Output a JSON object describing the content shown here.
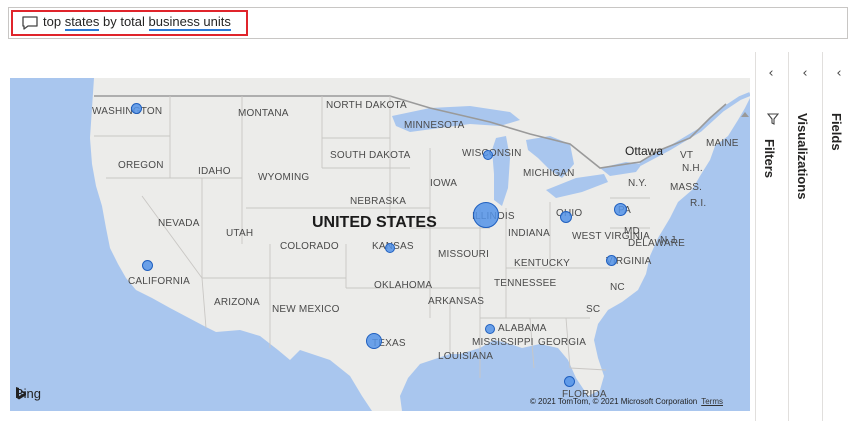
{
  "qa": {
    "query_parts": [
      {
        "text": "top ",
        "underline": false
      },
      {
        "text": "states",
        "underline": true
      },
      {
        "text": " by total ",
        "underline": false
      },
      {
        "text": "business units",
        "underline": true
      }
    ],
    "icon": "chat-bubble-icon",
    "highlight_color": "#e0242b"
  },
  "map": {
    "country_label": "UNITED STATES",
    "city_label": "Ottawa",
    "state_labels": [
      "WASHINGTON",
      "MONTANA",
      "NORTH DAKOTA",
      "MINNESOTA",
      "OREGON",
      "SOUTH DAKOTA",
      "WISCONSIN",
      "MICHIGAN",
      "IDAHO",
      "WYOMING",
      "IOWA",
      "NEBRASKA",
      "NEVADA",
      "UTAH",
      "ILLINOIS",
      "INDIANA",
      "OHIO",
      "COLORADO",
      "KANSAS",
      "MISSOURI",
      "CALIFORNIA",
      "KENTUCKY",
      "VIRGINIA",
      "WEST VIRGINIA",
      "OKLAHOMA",
      "TENNESSEE",
      "ARIZONA",
      "NEW MEXICO",
      "ARKANSAS",
      "NC",
      "SC",
      "ALABAMA",
      "MISSISSIPPI",
      "GEORGIA",
      "TEXAS",
      "LOUISIANA",
      "FLORIDA",
      "MAINE",
      "VT",
      "N.H.",
      "MASS.",
      "R.I.",
      "N.Y.",
      "PA",
      "MD",
      "DELAWARE",
      "N.J."
    ],
    "bubbles": [
      {
        "state": "WASHINGTON",
        "relative_size": 1
      },
      {
        "state": "CALIFORNIA",
        "relative_size": 1
      },
      {
        "state": "KANSAS",
        "relative_size": 0.8
      },
      {
        "state": "TEXAS",
        "relative_size": 2
      },
      {
        "state": "ILLINOIS",
        "relative_size": 3.5
      },
      {
        "state": "WISCONSIN",
        "relative_size": 0.8
      },
      {
        "state": "OHIO",
        "relative_size": 1.2
      },
      {
        "state": "PA",
        "relative_size": 1.4
      },
      {
        "state": "VIRGINIA",
        "relative_size": 1
      },
      {
        "state": "ALABAMA",
        "relative_size": 0.8
      },
      {
        "state": "FLORIDA",
        "relative_size": 1
      }
    ],
    "provider": "Bing",
    "copyright": "© 2021 TomTom, © 2021 Microsoft Corporation",
    "terms_label": "Terms",
    "colors": {
      "water": "#a9c6ee",
      "land": "#ececea",
      "bubble": "#5493e8"
    }
  },
  "panes": {
    "filters": {
      "label": "Filters",
      "chevron": "chevron-left-icon",
      "icon": "filter-icon"
    },
    "visualizations": {
      "label": "Visualizations",
      "chevron": "chevron-left-icon"
    },
    "fields": {
      "label": "Fields",
      "chevron": "chevron-left-icon"
    }
  }
}
